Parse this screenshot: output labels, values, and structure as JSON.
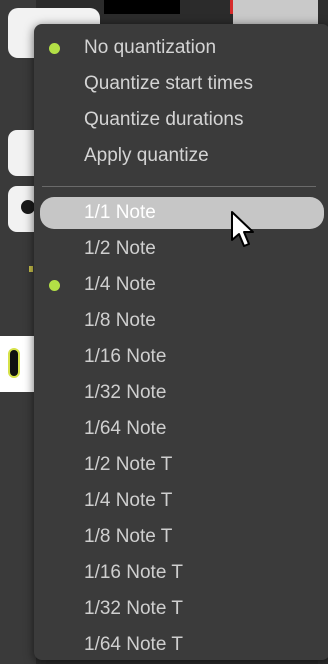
{
  "menu": {
    "mode_items": [
      {
        "label": "No quantization",
        "checked": true
      },
      {
        "label": "Quantize start times",
        "checked": false
      },
      {
        "label": "Quantize durations",
        "checked": false
      },
      {
        "label": "Apply quantize",
        "checked": false
      }
    ],
    "note_items": [
      {
        "label": "1/1 Note",
        "checked": false,
        "highlighted": true
      },
      {
        "label": "1/2 Note",
        "checked": false
      },
      {
        "label": "1/4 Note",
        "checked": true
      },
      {
        "label": "1/8 Note",
        "checked": false
      },
      {
        "label": "1/16 Note",
        "checked": false
      },
      {
        "label": "1/32 Note",
        "checked": false
      },
      {
        "label": "1/64 Note",
        "checked": false
      },
      {
        "label": "1/2 Note T",
        "checked": false
      },
      {
        "label": "1/4 Note T",
        "checked": false
      },
      {
        "label": "1/8 Note T",
        "checked": false
      },
      {
        "label": "1/16 Note T",
        "checked": false
      },
      {
        "label": "1/32 Note T",
        "checked": false
      },
      {
        "label": "1/64 Note T",
        "checked": false
      }
    ]
  },
  "colors": {
    "menu_bg": "#3b3b3b",
    "check_accent": "#b3e046",
    "highlight_bg": "#c6c6c6"
  },
  "icons": {
    "check": "check-dot-icon",
    "pointer": "mouse-pointer-icon"
  }
}
